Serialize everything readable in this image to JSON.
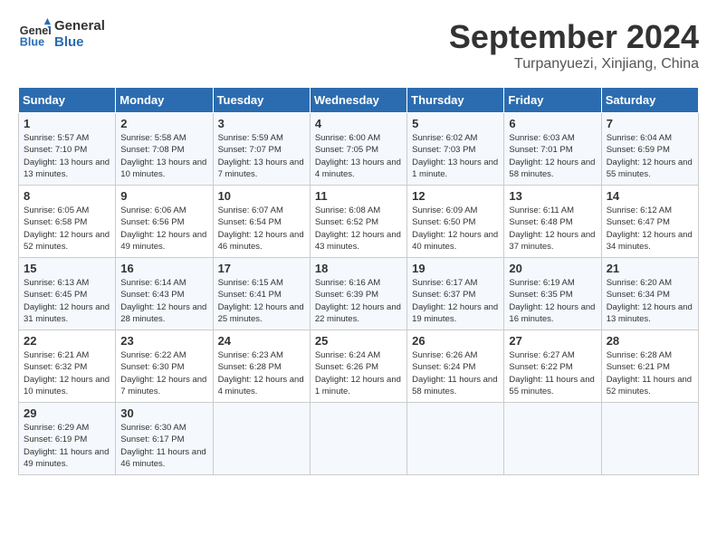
{
  "header": {
    "logo_line1": "General",
    "logo_line2": "Blue",
    "month": "September 2024",
    "location": "Turpanyuezi, Xinjiang, China"
  },
  "days_of_week": [
    "Sunday",
    "Monday",
    "Tuesday",
    "Wednesday",
    "Thursday",
    "Friday",
    "Saturday"
  ],
  "weeks": [
    [
      {
        "day": "1",
        "content": "Sunrise: 5:57 AM\nSunset: 7:10 PM\nDaylight: 13 hours\nand 13 minutes."
      },
      {
        "day": "2",
        "content": "Sunrise: 5:58 AM\nSunset: 7:08 PM\nDaylight: 13 hours\nand 10 minutes."
      },
      {
        "day": "3",
        "content": "Sunrise: 5:59 AM\nSunset: 7:07 PM\nDaylight: 13 hours\nand 7 minutes."
      },
      {
        "day": "4",
        "content": "Sunrise: 6:00 AM\nSunset: 7:05 PM\nDaylight: 13 hours\nand 4 minutes."
      },
      {
        "day": "5",
        "content": "Sunrise: 6:02 AM\nSunset: 7:03 PM\nDaylight: 13 hours\nand 1 minute."
      },
      {
        "day": "6",
        "content": "Sunrise: 6:03 AM\nSunset: 7:01 PM\nDaylight: 12 hours\nand 58 minutes."
      },
      {
        "day": "7",
        "content": "Sunrise: 6:04 AM\nSunset: 6:59 PM\nDaylight: 12 hours\nand 55 minutes."
      }
    ],
    [
      {
        "day": "8",
        "content": "Sunrise: 6:05 AM\nSunset: 6:58 PM\nDaylight: 12 hours\nand 52 minutes."
      },
      {
        "day": "9",
        "content": "Sunrise: 6:06 AM\nSunset: 6:56 PM\nDaylight: 12 hours\nand 49 minutes."
      },
      {
        "day": "10",
        "content": "Sunrise: 6:07 AM\nSunset: 6:54 PM\nDaylight: 12 hours\nand 46 minutes."
      },
      {
        "day": "11",
        "content": "Sunrise: 6:08 AM\nSunset: 6:52 PM\nDaylight: 12 hours\nand 43 minutes."
      },
      {
        "day": "12",
        "content": "Sunrise: 6:09 AM\nSunset: 6:50 PM\nDaylight: 12 hours\nand 40 minutes."
      },
      {
        "day": "13",
        "content": "Sunrise: 6:11 AM\nSunset: 6:48 PM\nDaylight: 12 hours\nand 37 minutes."
      },
      {
        "day": "14",
        "content": "Sunrise: 6:12 AM\nSunset: 6:47 PM\nDaylight: 12 hours\nand 34 minutes."
      }
    ],
    [
      {
        "day": "15",
        "content": "Sunrise: 6:13 AM\nSunset: 6:45 PM\nDaylight: 12 hours\nand 31 minutes."
      },
      {
        "day": "16",
        "content": "Sunrise: 6:14 AM\nSunset: 6:43 PM\nDaylight: 12 hours\nand 28 minutes."
      },
      {
        "day": "17",
        "content": "Sunrise: 6:15 AM\nSunset: 6:41 PM\nDaylight: 12 hours\nand 25 minutes."
      },
      {
        "day": "18",
        "content": "Sunrise: 6:16 AM\nSunset: 6:39 PM\nDaylight: 12 hours\nand 22 minutes."
      },
      {
        "day": "19",
        "content": "Sunrise: 6:17 AM\nSunset: 6:37 PM\nDaylight: 12 hours\nand 19 minutes."
      },
      {
        "day": "20",
        "content": "Sunrise: 6:19 AM\nSunset: 6:35 PM\nDaylight: 12 hours\nand 16 minutes."
      },
      {
        "day": "21",
        "content": "Sunrise: 6:20 AM\nSunset: 6:34 PM\nDaylight: 12 hours\nand 13 minutes."
      }
    ],
    [
      {
        "day": "22",
        "content": "Sunrise: 6:21 AM\nSunset: 6:32 PM\nDaylight: 12 hours\nand 10 minutes."
      },
      {
        "day": "23",
        "content": "Sunrise: 6:22 AM\nSunset: 6:30 PM\nDaylight: 12 hours\nand 7 minutes."
      },
      {
        "day": "24",
        "content": "Sunrise: 6:23 AM\nSunset: 6:28 PM\nDaylight: 12 hours\nand 4 minutes."
      },
      {
        "day": "25",
        "content": "Sunrise: 6:24 AM\nSunset: 6:26 PM\nDaylight: 12 hours\nand 1 minute."
      },
      {
        "day": "26",
        "content": "Sunrise: 6:26 AM\nSunset: 6:24 PM\nDaylight: 11 hours\nand 58 minutes."
      },
      {
        "day": "27",
        "content": "Sunrise: 6:27 AM\nSunset: 6:22 PM\nDaylight: 11 hours\nand 55 minutes."
      },
      {
        "day": "28",
        "content": "Sunrise: 6:28 AM\nSunset: 6:21 PM\nDaylight: 11 hours\nand 52 minutes."
      }
    ],
    [
      {
        "day": "29",
        "content": "Sunrise: 6:29 AM\nSunset: 6:19 PM\nDaylight: 11 hours\nand 49 minutes."
      },
      {
        "day": "30",
        "content": "Sunrise: 6:30 AM\nSunset: 6:17 PM\nDaylight: 11 hours\nand 46 minutes."
      },
      {
        "day": "",
        "content": ""
      },
      {
        "day": "",
        "content": ""
      },
      {
        "day": "",
        "content": ""
      },
      {
        "day": "",
        "content": ""
      },
      {
        "day": "",
        "content": ""
      }
    ]
  ]
}
